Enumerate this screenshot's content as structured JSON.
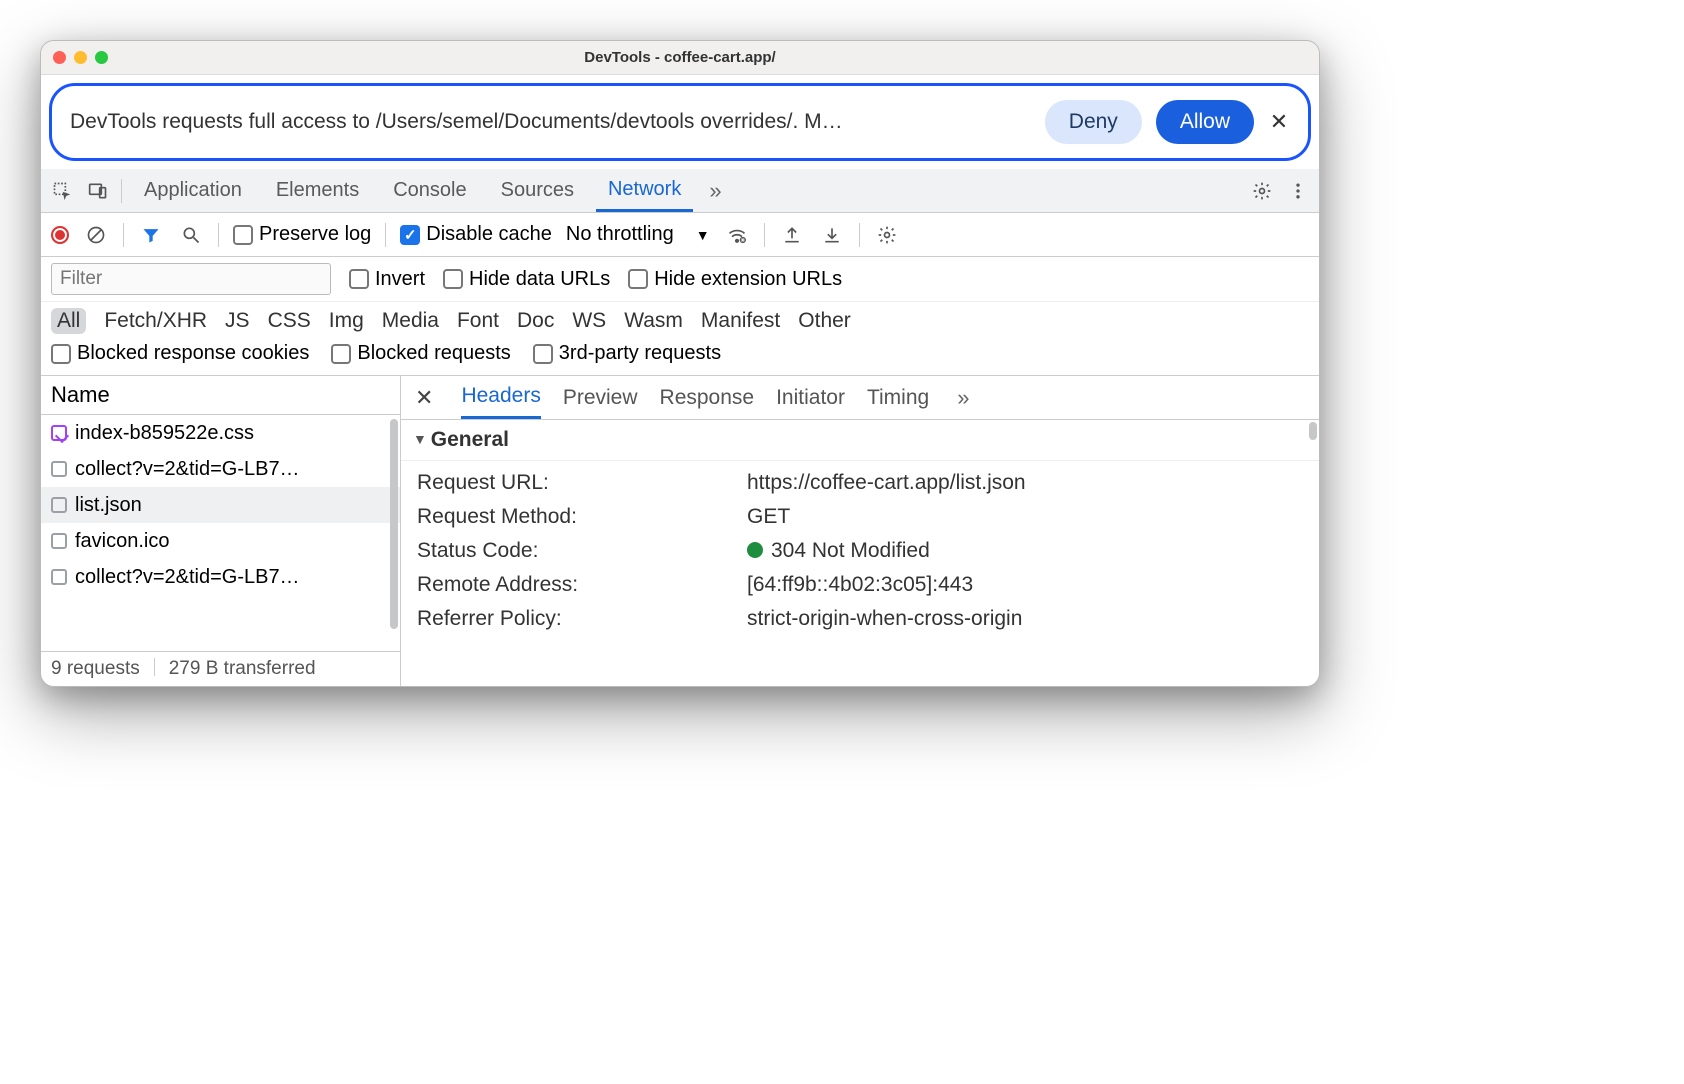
{
  "window": {
    "title": "DevTools - coffee-cart.app/"
  },
  "permission": {
    "message": "DevTools requests full access to /Users/semel/Documents/devtools overrides/. M…",
    "deny": "Deny",
    "allow": "Allow"
  },
  "tabs": {
    "items": [
      "Application",
      "Elements",
      "Console",
      "Sources",
      "Network"
    ],
    "active": "Network"
  },
  "network_toolbar": {
    "preserve_log": "Preserve log",
    "disable_cache": "Disable cache",
    "throttling": "No throttling"
  },
  "filter": {
    "placeholder": "Filter",
    "invert": "Invert",
    "hide_data": "Hide data URLs",
    "hide_ext": "Hide extension URLs"
  },
  "types": [
    "All",
    "Fetch/XHR",
    "JS",
    "CSS",
    "Img",
    "Media",
    "Font",
    "Doc",
    "WS",
    "Wasm",
    "Manifest",
    "Other"
  ],
  "blocked": {
    "cookies": "Blocked response cookies",
    "requests": "Blocked requests",
    "third": "3rd-party requests"
  },
  "left": {
    "header": "Name",
    "rows": [
      {
        "name": "index-b859522e.css",
        "mapped": true,
        "selected": false
      },
      {
        "name": "collect?v=2&tid=G-LB7…",
        "mapped": false,
        "selected": false
      },
      {
        "name": "list.json",
        "mapped": false,
        "selected": true
      },
      {
        "name": "favicon.ico",
        "mapped": false,
        "selected": false
      },
      {
        "name": "collect?v=2&tid=G-LB7…",
        "mapped": false,
        "selected": false
      }
    ],
    "footer": {
      "requests": "9 requests",
      "transferred": "279 B transferred"
    }
  },
  "detail": {
    "tabs": [
      "Headers",
      "Preview",
      "Response",
      "Initiator",
      "Timing"
    ],
    "active": "Headers",
    "section": "General",
    "rows": [
      {
        "k": "Request URL:",
        "v": "https://coffee-cart.app/list.json"
      },
      {
        "k": "Request Method:",
        "v": "GET"
      },
      {
        "k": "Status Code:",
        "v": "304 Not Modified",
        "status": true
      },
      {
        "k": "Remote Address:",
        "v": "[64:ff9b::4b02:3c05]:443"
      },
      {
        "k": "Referrer Policy:",
        "v": "strict-origin-when-cross-origin"
      }
    ]
  }
}
